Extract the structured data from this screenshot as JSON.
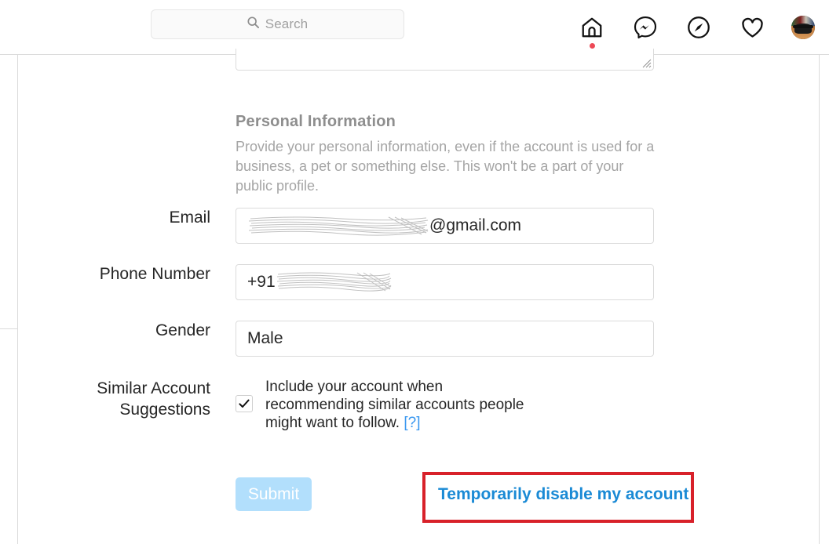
{
  "header": {
    "search": {
      "placeholder": "Search",
      "value": "",
      "icon": "search-icon"
    },
    "nav": [
      {
        "name": "home-icon",
        "label": "Home",
        "has_notification_dot": true,
        "dot_color": "#ed4956"
      },
      {
        "name": "messenger-icon",
        "label": "Messages",
        "has_notification_dot": false
      },
      {
        "name": "explore-compass-icon",
        "label": "Explore",
        "has_notification_dot": false
      },
      {
        "name": "heart-icon",
        "label": "Activity",
        "has_notification_dot": false
      },
      {
        "name": "profile-avatar",
        "label": "Profile",
        "has_notification_dot": false
      }
    ]
  },
  "section": {
    "title": "Personal Information",
    "description": "Provide your personal information, even if the account is used for a business, a pet or something else. This won't be a part of your public profile."
  },
  "fields": {
    "email": {
      "label": "Email",
      "value_visible": "@gmail.com",
      "redacted": true,
      "redaction_note": "username scribbled out"
    },
    "phone": {
      "label": "Phone Number",
      "value_visible": "+91",
      "redacted": true,
      "redaction_note": "digits scribbled out"
    },
    "gender": {
      "label": "Gender",
      "value": "Male"
    },
    "similar_accounts": {
      "label": "Similar Account Suggestions",
      "checkbox_checked": true,
      "text": "Include your account when recommending similar accounts people might want to follow.",
      "help_label": "[?]"
    }
  },
  "actions": {
    "submit_label": "Submit",
    "submit_disabled": true,
    "disable_account_label": "Temporarily disable my account"
  },
  "colors": {
    "link_blue": "#1a8ad5",
    "help_blue": "#3897f0",
    "submit_disabled_blue": "#b2dffc",
    "highlight_red": "#d8212a",
    "notification_red": "#ed4956",
    "text_dark": "#262626",
    "text_muted": "#8e8e8e",
    "border": "#dbdbdb"
  }
}
